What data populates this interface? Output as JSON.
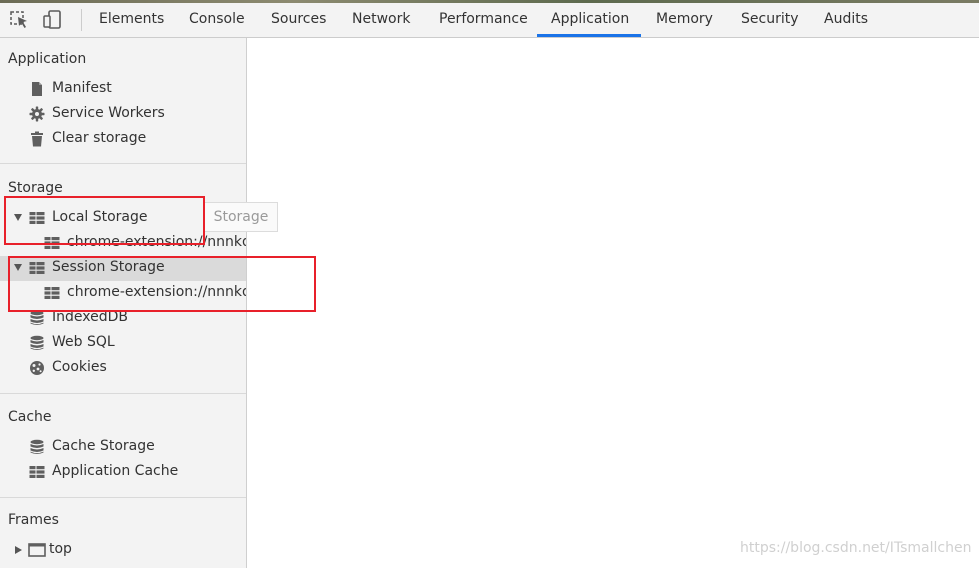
{
  "toolbar": {
    "inspect_icon": "inspect-element-icon",
    "device_icon": "device-toolbar-icon",
    "tabs": [
      "Elements",
      "Console",
      "Sources",
      "Network",
      "Performance",
      "Application",
      "Memory",
      "Security",
      "Audits"
    ],
    "active_tab": "Application",
    "accent_color": "#1a73e8"
  },
  "sidebar": {
    "application": {
      "title": "Application",
      "items": [
        {
          "label": "Manifest",
          "icon": "file-icon"
        },
        {
          "label": "Service Workers",
          "icon": "gear-icon"
        },
        {
          "label": "Clear storage",
          "icon": "trash-icon"
        }
      ]
    },
    "storage": {
      "title": "Storage",
      "local_storage": {
        "label": "Local Storage",
        "icon": "grid-icon",
        "child": "chrome-extension://nnnkdc"
      },
      "session_storage": {
        "label": "Session Storage",
        "icon": "grid-icon",
        "child": "chrome-extension://nnnkdc"
      },
      "items": [
        {
          "label": "IndexedDB",
          "icon": "database-icon"
        },
        {
          "label": "Web SQL",
          "icon": "database-icon"
        },
        {
          "label": "Cookies",
          "icon": "cookie-icon"
        }
      ]
    },
    "cache": {
      "title": "Cache",
      "items": [
        {
          "label": "Cache Storage",
          "icon": "database-icon"
        },
        {
          "label": "Application Cache",
          "icon": "grid-icon"
        }
      ]
    },
    "frames": {
      "title": "Frames",
      "items": [
        {
          "label": "top",
          "icon": "frame-icon"
        }
      ]
    }
  },
  "tooltip": {
    "text": "Storage"
  },
  "annotation_color": "#e8202a",
  "watermark": "https://blog.csdn.net/ITsmallchen"
}
